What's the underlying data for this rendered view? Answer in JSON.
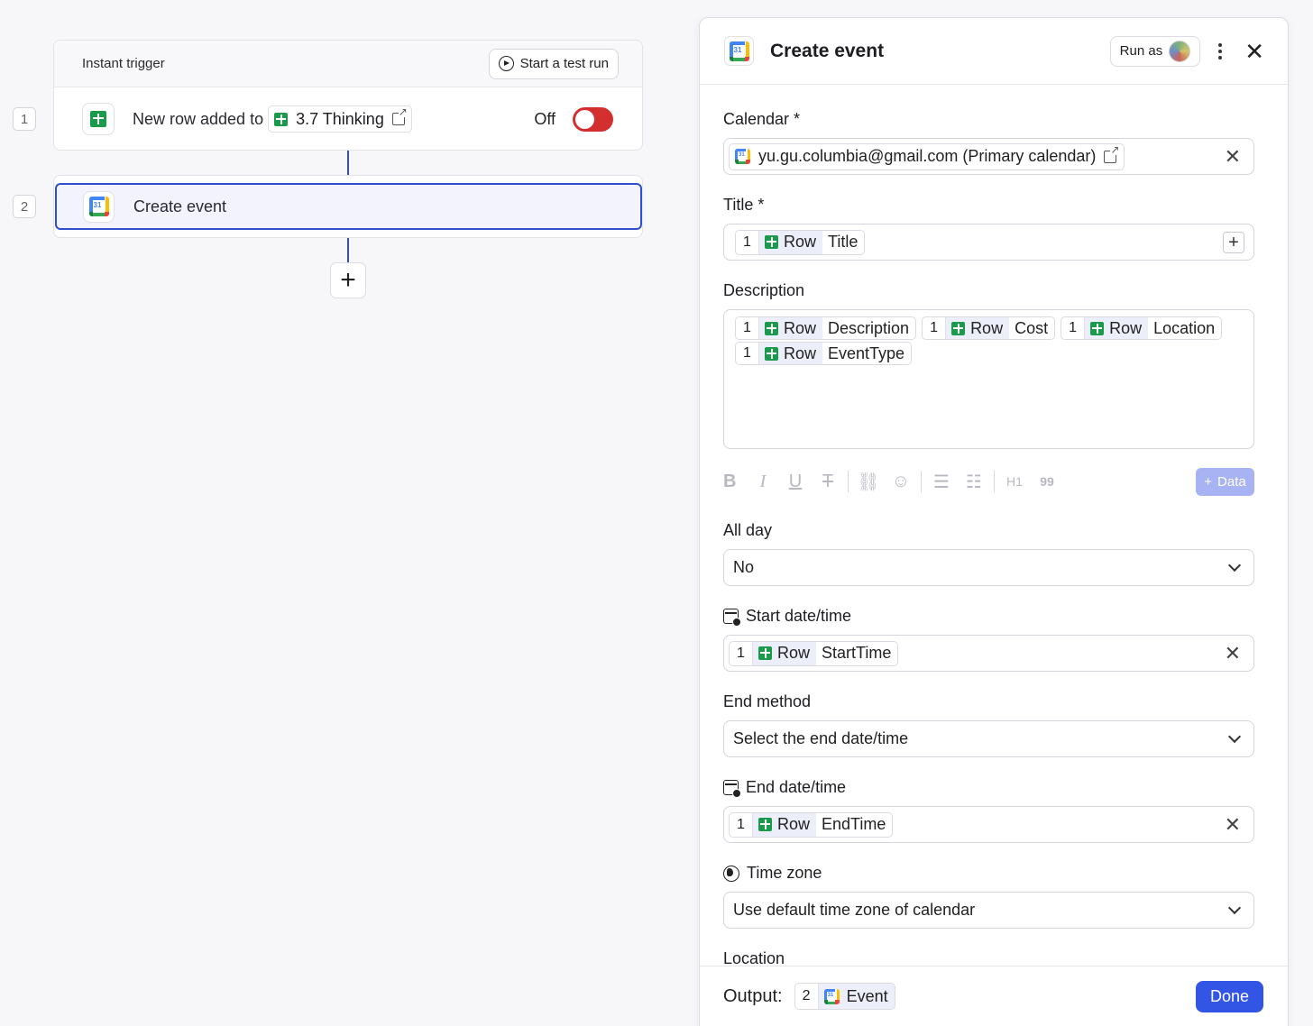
{
  "flow": {
    "trigger": {
      "step_number": "1",
      "label": "Instant trigger",
      "test_run_label": "Start a test run",
      "description": "New row added to",
      "sheet_name": "3.7 Thinking",
      "status_label": "Off"
    },
    "action": {
      "step_number": "2",
      "label": "Create event"
    },
    "add_step": "+"
  },
  "panel": {
    "title": "Create event",
    "run_as_label": "Run as",
    "fields": {
      "calendar": {
        "label": "Calendar *",
        "value": "yu.gu.columbia@gmail.com (Primary calendar)"
      },
      "title": {
        "label": "Title *",
        "tokens": [
          {
            "num": "1",
            "source": "Row",
            "column": "Title"
          }
        ]
      },
      "description": {
        "label": "Description",
        "tokens": [
          {
            "num": "1",
            "source": "Row",
            "column": "Description"
          },
          {
            "num": "1",
            "source": "Row",
            "column": "Cost"
          },
          {
            "num": "1",
            "source": "Row",
            "column": "Location"
          },
          {
            "num": "1",
            "source": "Row",
            "column": "EventType"
          }
        ]
      },
      "toolbar": {
        "h1": "H1",
        "quote": "99",
        "data_label": "Data"
      },
      "all_day": {
        "label": "All day",
        "value": "No"
      },
      "start": {
        "label": "Start date/time",
        "tokens": [
          {
            "num": "1",
            "source": "Row",
            "column": "StartTime"
          }
        ]
      },
      "end_method": {
        "label": "End method",
        "value": "Select the end date/time"
      },
      "end": {
        "label": "End date/time",
        "tokens": [
          {
            "num": "1",
            "source": "Row",
            "column": "EndTime"
          }
        ]
      },
      "time_zone": {
        "label": "Time zone",
        "value": "Use default time zone of calendar"
      },
      "location": {
        "label": "Location"
      }
    },
    "footer": {
      "output_label": "Output:",
      "output_num": "2",
      "output_name": "Event",
      "done_label": "Done"
    }
  },
  "colors": {
    "accent": "#3355e6",
    "toggle_off": "#d42f2f",
    "sheets_green": "#1a9b4c"
  }
}
